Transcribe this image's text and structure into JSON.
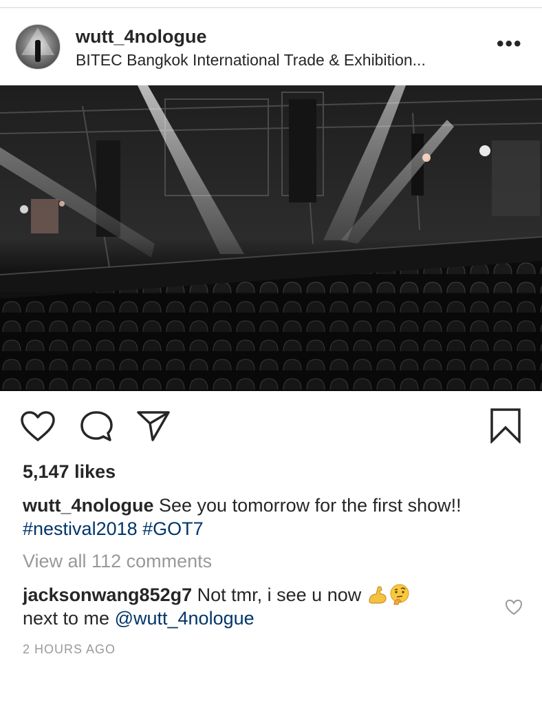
{
  "post": {
    "username": "wutt_4nologue",
    "location": "BITEC Bangkok International Trade & Exhibition...",
    "more_label": "•••"
  },
  "photo": {
    "description_icon": "concert-hall-photo"
  },
  "actions": {
    "like_icon": "heart-icon",
    "comment_icon": "comment-icon",
    "share_icon": "paper-plane-icon",
    "save_icon": "bookmark-icon"
  },
  "likes": "5,147 likes",
  "caption": {
    "user": "wutt_4nologue",
    "text": " See you tomorrow for the first show!!",
    "hashtag1": "#nestival2018",
    "hashtag2": "#GOT7"
  },
  "view_all_comments": "View all 112 comments",
  "comment": {
    "user": "jacksonwang852g7",
    "text": " Not tmr, i see u now ",
    "emoji1": "flexed-biceps-icon",
    "emoji2": "thinking-face-icon",
    "text2": "next to me ",
    "mention": "@wutt_4nologue"
  },
  "timestamp": "2 HOURS AGO",
  "colors": {
    "text": "#262626",
    "muted": "#999999",
    "link": "#003569"
  }
}
